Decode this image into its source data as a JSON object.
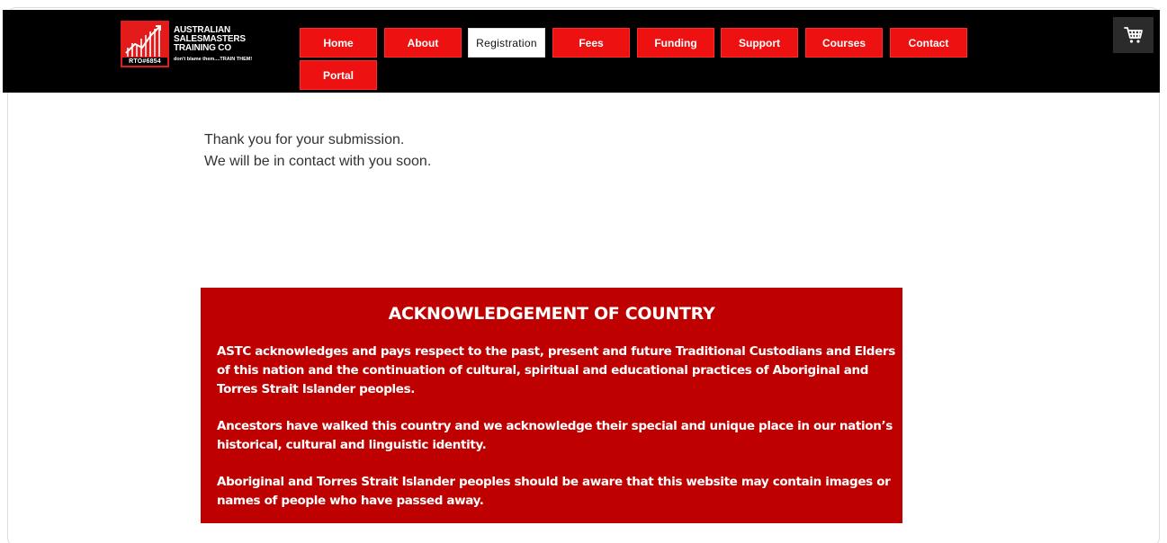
{
  "logo": {
    "rto": "RTO#6854",
    "line1": "AUSTRALIAN",
    "line2": "SALESMASTERS",
    "line3": "TRAINING CO",
    "tagline": "don't blame them....TRAIN THEM!"
  },
  "nav": {
    "home": "Home",
    "about": "About",
    "registration": "Registration",
    "fees": "Fees",
    "funding": "Funding",
    "support": "Support",
    "courses": "Courses",
    "contact": "Contact",
    "portal": "Portal",
    "active": "Registration"
  },
  "cart": {
    "icon": "cart-icon"
  },
  "confirmation": {
    "line1": "Thank you for your submission.",
    "line2": "We will be in contact with you soon."
  },
  "acknowledgement": {
    "title": "ACKNOWLEDGEMENT OF COUNTRY",
    "p1": "ASTC acknowledges and pays respect to the past, present and future Traditional Custodians and Elders of this nation and the continuation of cultural, spiritual and educational practices of Aboriginal and Torres Strait Islander peoples.",
    "p2": "Ancestors have walked this country and we acknowledge their special and unique place in our nation’s historical, cultural and linguistic identity.",
    "p3": "Aboriginal and Torres Strait Islander peoples should be aware that this website may contain images or names of people who have passed away."
  },
  "colors": {
    "header_bg": "#000000",
    "nav_red": "#ee1111",
    "ack_red": "#bf0000",
    "cart_bg": "#2b2b2b"
  }
}
